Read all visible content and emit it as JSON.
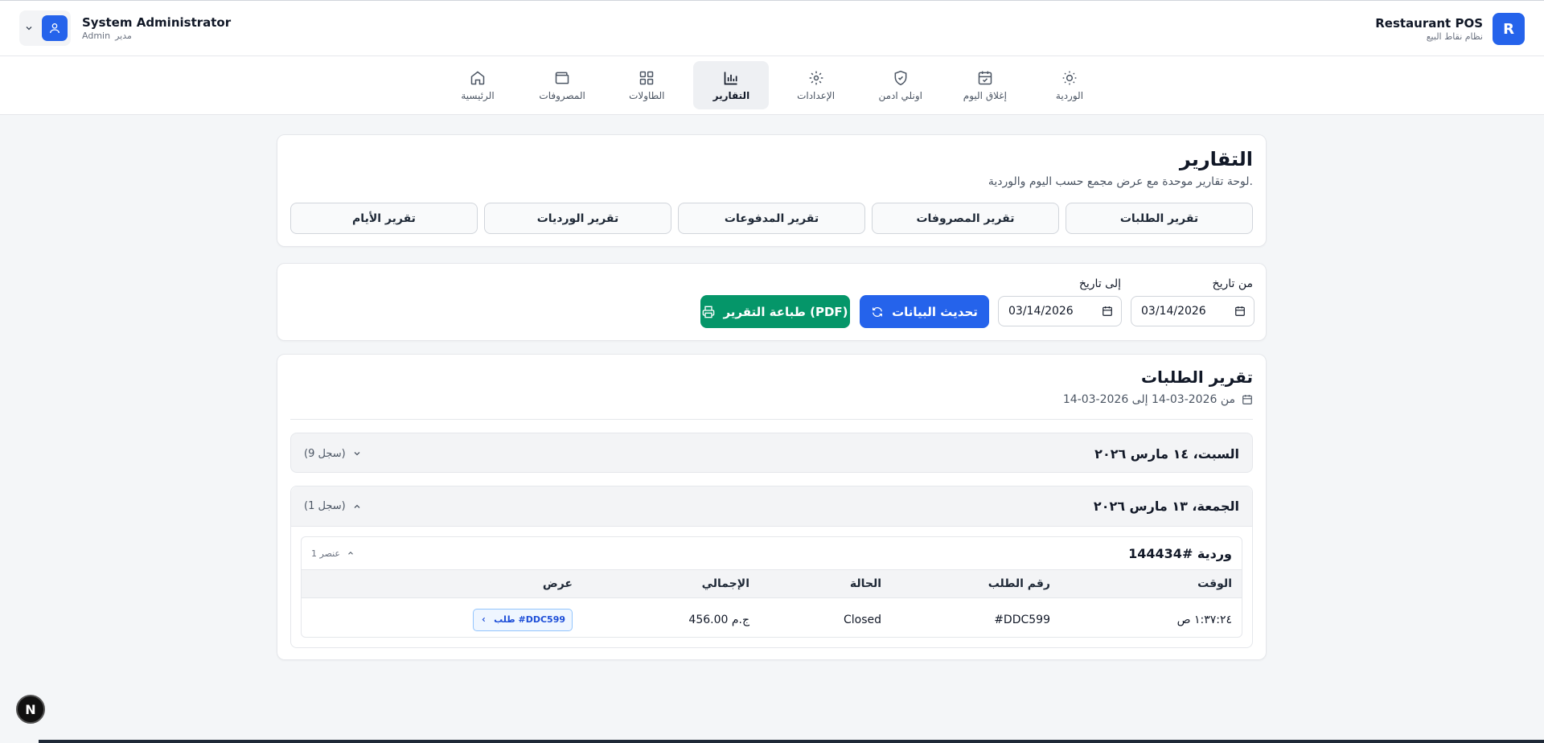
{
  "header": {
    "brand_initial": "R",
    "brand_name": "Restaurant POS",
    "brand_subtitle": "نظام نقاط البيع",
    "user_name": "System Administrator",
    "user_role_en": "Admin",
    "user_role_ar": "مدير"
  },
  "nav": {
    "items": [
      {
        "label": "الوردية",
        "icon": "sun-icon"
      },
      {
        "label": "إغلاق اليوم",
        "icon": "calendar-check-icon"
      },
      {
        "label": "اونلي ادمن",
        "icon": "shield-check-icon"
      },
      {
        "label": "الإعدادات",
        "icon": "gear-icon"
      },
      {
        "label": "التقارير",
        "icon": "bar-chart-icon",
        "active": true
      },
      {
        "label": "الطاولات",
        "icon": "grid-icon"
      },
      {
        "label": "المصروفات",
        "icon": "wallet-icon"
      },
      {
        "label": "الرئيسية",
        "icon": "home-icon"
      }
    ]
  },
  "reports": {
    "title": "التقارير",
    "subtitle": "لوحة تقارير موحدة مع عرض مجمع حسب اليوم والوردية.",
    "tabs": [
      "تقرير الطلبات",
      "تقرير المصروفات",
      "تقرير المدفوعات",
      "تقرير الورديات",
      "تقرير الأيام"
    ]
  },
  "filters": {
    "from_label": "من تاريخ",
    "to_label": "إلى تاريخ",
    "from_value": "03/14/2026",
    "to_value": "03/14/2026",
    "refresh_label": "تحديث البيانات",
    "print_label": "طباعة التقرير (PDF)"
  },
  "orders_report": {
    "title": "تقرير الطلبات",
    "range": "من 2026-03-14 إلى 2026-03-14",
    "days": [
      {
        "label": "السبت، ١٤ مارس ٢٠٢٦",
        "count": "(9 سجل)",
        "expanded": false
      },
      {
        "label": "الجمعة، ١٣ مارس ٢٠٢٦",
        "count": "(1 سجل)",
        "expanded": true
      }
    ],
    "shift": {
      "title": "وردية #144434",
      "count": "1 عنصر",
      "columns": [
        "الوقت",
        "رقم الطلب",
        "الحالة",
        "الإجمالي",
        "عرض"
      ],
      "rows": [
        {
          "time": "١:٣٧:٢٤ ص",
          "order_no": "#DDC599",
          "status": "Closed",
          "total": "456.00 ج.م",
          "view": "طلب #DDC599"
        }
      ]
    }
  },
  "dev_badge": "N"
}
